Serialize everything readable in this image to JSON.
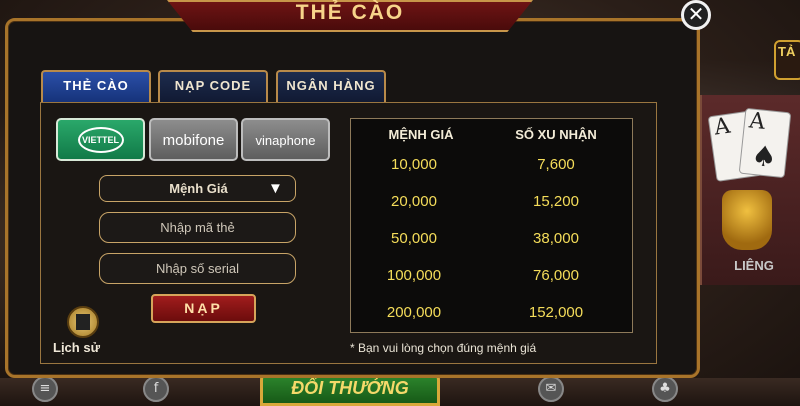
{
  "dialog": {
    "title": "THẺ CÀO",
    "close_symbol": "✕"
  },
  "tabs": [
    {
      "label": "THẺ CÀO",
      "active": true
    },
    {
      "label": "NẠP CODE",
      "active": false
    },
    {
      "label": "NGÂN HÀNG",
      "active": false
    }
  ],
  "carriers": [
    {
      "label": "VIETTEL",
      "selected": true
    },
    {
      "label": "mobifone",
      "selected": false
    },
    {
      "label": "vinaphone",
      "selected": false
    }
  ],
  "form": {
    "denomination_label": "Mệnh Giá",
    "card_code_placeholder": "Nhập mã thẻ",
    "serial_placeholder": "Nhập số serial",
    "submit_label": "NẠP"
  },
  "history": {
    "label": "Lịch sử"
  },
  "price_table": {
    "headers": [
      "MỆNH GIÁ",
      "SỐ XU NHẬN"
    ],
    "rows": [
      [
        "10,000",
        "7,600"
      ],
      [
        "20,000",
        "15,200"
      ],
      [
        "50,000",
        "38,000"
      ],
      [
        "100,000",
        "76,000"
      ],
      [
        "200,000",
        "152,000"
      ]
    ]
  },
  "note": "* Bạn vui lòng chọn đúng mệnh giá",
  "background": {
    "right_game_label": "LIÊNG",
    "right_tag": "TẢ",
    "bottom_button": "ĐỔI THƯỞNG"
  },
  "colors": {
    "accent_gold": "#c8964a",
    "value_yellow": "#f5dd5a",
    "tab_active_blue": "#2b4fa8",
    "banner_red": "#6e1414",
    "viettel_green": "#117a48"
  }
}
